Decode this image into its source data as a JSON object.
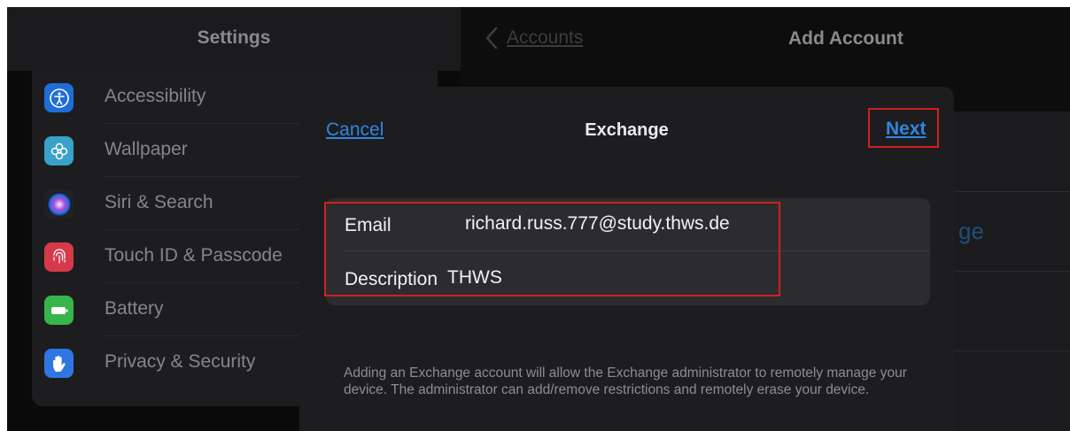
{
  "settings": {
    "title": "Settings",
    "items": [
      {
        "label": "Accessibility",
        "icon": "accessibility-icon",
        "color": "#1e6ed8"
      },
      {
        "label": "Wallpaper",
        "icon": "flower-icon",
        "color": "#3aa1c9"
      },
      {
        "label": "Siri & Search",
        "icon": "siri-icon",
        "color": "#222"
      },
      {
        "label": "Touch ID & Passcode",
        "icon": "fingerprint-icon",
        "color": "#d63a4a"
      },
      {
        "label": "Battery",
        "icon": "battery-icon",
        "color": "#37b54a"
      },
      {
        "label": "Privacy & Security",
        "icon": "hand-icon",
        "color": "#2f76e0"
      }
    ]
  },
  "add_account": {
    "back_label": "Accounts",
    "title": "Add Account",
    "background_fragment": "ge"
  },
  "modal": {
    "cancel_label": "Cancel",
    "title": "Exchange",
    "next_label": "Next",
    "fields": {
      "email_label": "Email",
      "email_value": "richard.russ.777@study.thws.de",
      "description_label": "Description",
      "description_value": "THWS"
    },
    "info_text": "Adding an Exchange account will allow the Exchange administrator to remotely manage your device. The administrator can add/remove restrictions and remotely erase your device."
  },
  "colors": {
    "accent": "#2f86e0",
    "highlight": "#d11f1f",
    "modal_bg": "#1d1d1f"
  }
}
